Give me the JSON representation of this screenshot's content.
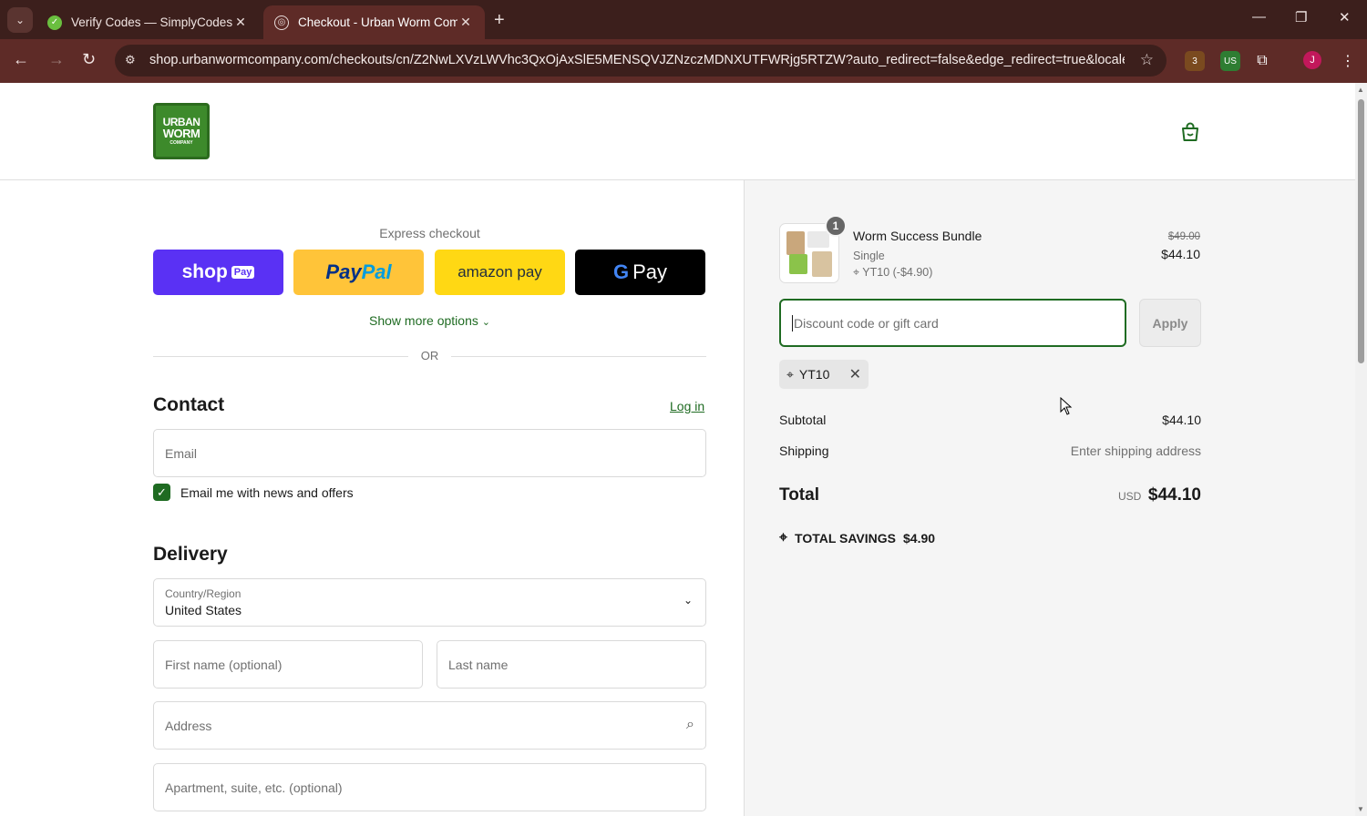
{
  "browser": {
    "tabs": [
      {
        "title": "Verify Codes — SimplyCodes",
        "active": false
      },
      {
        "title": "Checkout - Urban Worm Company",
        "active": true
      }
    ],
    "url": "shop.urbanwormcompany.com/checkouts/cn/Z2NwLXVzLWVhc3QxOjAxSlE5MENSQVJZNzczMDNXUTFWRjg5RTZW?auto_redirect=false&edge_redirect=true&locale...",
    "profile_initial": "J",
    "ext_badge": "3",
    "ext_vpn_label": "US"
  },
  "brand": {
    "logo_line1": "URBAN",
    "logo_line2": "WORM",
    "logo_line3": "COMPANY"
  },
  "express": {
    "label": "Express checkout",
    "shop_pay": {
      "text": "shop",
      "badge": "Pay"
    },
    "paypal": {
      "part1": "Pay",
      "part2": "Pal"
    },
    "amazon_pay": "amazon pay",
    "gpay": {
      "g": "G",
      "text": "Pay"
    },
    "show_more": "Show more options",
    "or": "OR"
  },
  "contact": {
    "heading": "Contact",
    "login": "Log in",
    "email_placeholder": "Email",
    "newsletter_label": "Email me with news and offers",
    "newsletter_checked": true
  },
  "delivery": {
    "heading": "Delivery",
    "country_label": "Country/Region",
    "country_value": "United States",
    "first_name_placeholder": "First name (optional)",
    "last_name_placeholder": "Last name",
    "address_placeholder": "Address",
    "apartment_placeholder": "Apartment, suite, etc. (optional)"
  },
  "summary": {
    "product": {
      "name": "Worm Success Bundle",
      "variant": "Single",
      "discount_line": "YT10 (-$4.90)",
      "original_price": "$49.00",
      "price": "$44.10",
      "quantity": "1"
    },
    "discount_placeholder": "Discount code or gift card",
    "apply_label": "Apply",
    "applied_code": "YT10",
    "subtotal_label": "Subtotal",
    "subtotal_value": "$44.10",
    "shipping_label": "Shipping",
    "shipping_value": "Enter shipping address",
    "total_label": "Total",
    "currency": "USD",
    "total_value": "$44.10",
    "savings_label": "TOTAL SAVINGS",
    "savings_value": "$4.90"
  },
  "colors": {
    "accent": "#1f6b22",
    "chrome_dark": "#3c1f1c",
    "chrome_toolbar": "#5e2b27",
    "shop_pay": "#5a31f4",
    "paypal": "#ffc439",
    "amazon": "#ffd814"
  }
}
